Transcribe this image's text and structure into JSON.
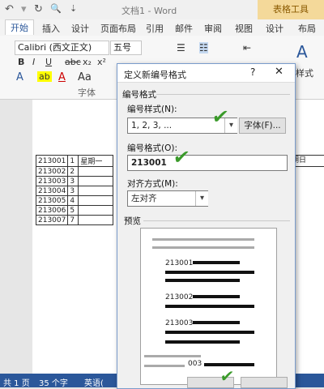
{
  "window": {
    "title": "文档1 - Word",
    "context_tab": "表格工具"
  },
  "quick_access": {
    "undo": "↶",
    "redo": "↻",
    "preview": "🔍",
    "more": "⇣"
  },
  "tabs": [
    "开始",
    "插入",
    "设计",
    "页面布局",
    "引用",
    "邮件",
    "审阅",
    "视图",
    "设计",
    "布局"
  ],
  "ribbon": {
    "font_name": "Calibri (西文正文)",
    "font_size": "五号",
    "font_group_label": "字体",
    "styles_label": "样式",
    "bold": "B",
    "italic": "I",
    "underline": "U",
    "strike": "abc",
    "sub": "x₂",
    "sup": "x²"
  },
  "document": {
    "rows": [
      {
        "id": "213001",
        "n": "1",
        "day": "星期一"
      },
      {
        "id": "213002",
        "n": "2",
        "day": ""
      },
      {
        "id": "213003",
        "n": "3",
        "day": ""
      },
      {
        "id": "213004",
        "n": "3",
        "day": ""
      },
      {
        "id": "213005",
        "n": "4",
        "day": ""
      },
      {
        "id": "213006",
        "n": "5",
        "day": ""
      },
      {
        "id": "213007",
        "n": "7",
        "day": ""
      }
    ],
    "right_cell": "期日"
  },
  "status": {
    "page": "共 1 页",
    "words": "35 个字",
    "lang": "英语("
  },
  "dialog": {
    "title": "定义新编号格式",
    "help": "?",
    "close": "✕",
    "section_label": "编号格式",
    "style_label": "编号样式(N):",
    "style_value": "1, 2, 3, ...",
    "font_button": "字体(F)...",
    "format_label": "编号格式(O):",
    "format_value": "213001",
    "align_label": "对齐方式(M):",
    "align_value": "左对齐",
    "preview_label": "预览",
    "preview_numbers": [
      "213001",
      "213002",
      "213003"
    ],
    "preview_tail": "003"
  }
}
